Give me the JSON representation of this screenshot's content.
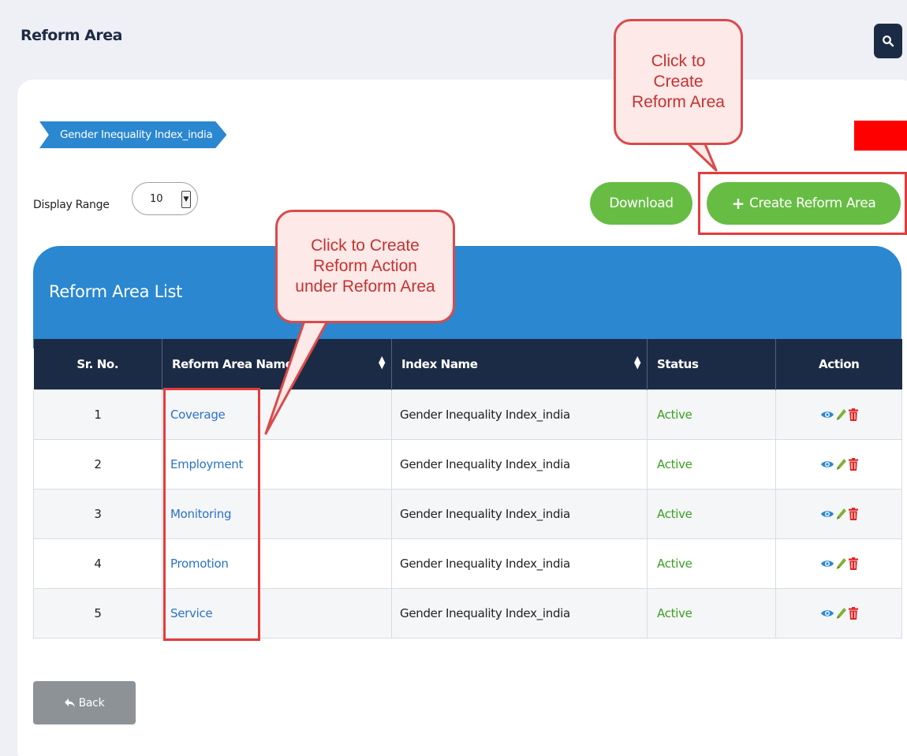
{
  "header": {
    "title": "Reform Area",
    "search_icon": "search-icon"
  },
  "breadcrumb": {
    "item": "Gender Inequality Index_india"
  },
  "toolbar": {
    "display_range_label": "Display Range",
    "display_range_value": "10",
    "download_label": "Download",
    "create_label": "Create Reform Area",
    "create_icon": "plus-icon"
  },
  "list": {
    "title": "Reform Area List",
    "columns": [
      "Sr. No.",
      "Reform Area Name",
      "Index Name",
      "Status",
      "Action"
    ],
    "rows": [
      {
        "sr": "1",
        "name": "Coverage",
        "index": "Gender Inequality Index_india",
        "status": "Active"
      },
      {
        "sr": "2",
        "name": "Employment",
        "index": "Gender Inequality Index_india",
        "status": "Active"
      },
      {
        "sr": "3",
        "name": "Monitoring",
        "index": "Gender Inequality Index_india",
        "status": "Active"
      },
      {
        "sr": "4",
        "name": "Promotion",
        "index": "Gender Inequality Index_india",
        "status": "Active"
      },
      {
        "sr": "5",
        "name": "Service",
        "index": "Gender Inequality Index_india",
        "status": "Active"
      }
    ],
    "action_icons": [
      "eye-icon",
      "pencil-icon",
      "trash-icon"
    ]
  },
  "footer": {
    "back_label": "Back",
    "back_icon": "reply-icon"
  },
  "annotations": {
    "callout_create_area": [
      "Click to",
      "Create",
      "Reform Area"
    ],
    "callout_create_action": [
      "Click to Create",
      "Reform Action",
      "under Reform Area"
    ]
  },
  "colors": {
    "primary_blue": "#2a87d0",
    "header_navy": "#1c2b45",
    "button_green": "#67bd44",
    "status_green": "#3a9f20",
    "link_blue": "#2a72c7",
    "annotation_red": "#d94b4b"
  }
}
